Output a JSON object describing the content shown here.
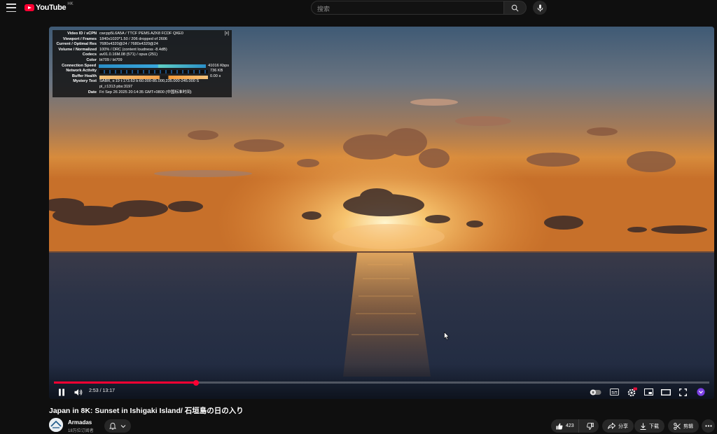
{
  "masthead": {
    "logo_text": "YouTube",
    "region": "HK",
    "search_placeholder": "搜索"
  },
  "stats": {
    "close_label": "[x]",
    "rows": [
      {
        "key": "Video ID / sCPN",
        "value": "cwcpp5L6A5A / TTCF PEMS AZK8 FCDF QKE0"
      },
      {
        "key": "Viewport / Frames",
        "value": "1840x1020*1.50 / 206 dropped of 2606"
      },
      {
        "key": "Current / Optimal Res",
        "value": "7680x4320@24 / 7680x4320@24"
      },
      {
        "key": "Volume / Normalized",
        "value": "100% / DRC (content loudness -8.4dB)"
      },
      {
        "key": "Codecs",
        "value": "av01.0.16M.08 (571) / opus (251)"
      },
      {
        "key": "Color",
        "value": "bt709 / bt709"
      },
      {
        "key": "Connection Speed",
        "value": "41016 Kbps"
      },
      {
        "key": "Network Activity",
        "value": "736 KB"
      },
      {
        "key": "Buffer Health",
        "value": "0.00 s"
      },
      {
        "key": "Mystery Text",
        "value": "SABR, s:19 t:173.63 b:60.000-85.000,235.000-245.000 S"
      },
      {
        "key": "",
        "value": "pl_i:1313 pbs:3197"
      },
      {
        "key": "Date",
        "value": "Fri Sep 26 2025 20:14:35 GMT+0800 (中国标准时间)"
      }
    ]
  },
  "player": {
    "time_display": "2:53 / 13:17",
    "progress_fraction": 0.217,
    "buffered_fraction": 0.22,
    "settings_badge": "8K"
  },
  "video": {
    "title": "Japan in 8K: Sunset in Ishigaki Island/ 石垣島の日の入り",
    "channel": "Armadas",
    "subscribers": "18万位订阅者"
  },
  "actions": {
    "like_count": "423",
    "share_label": "分享",
    "download_label": "下载",
    "clip_label": "剪辑"
  },
  "colors": {
    "accent": "#ff0033",
    "background": "#0f0f0f",
    "pill": "#272727"
  }
}
